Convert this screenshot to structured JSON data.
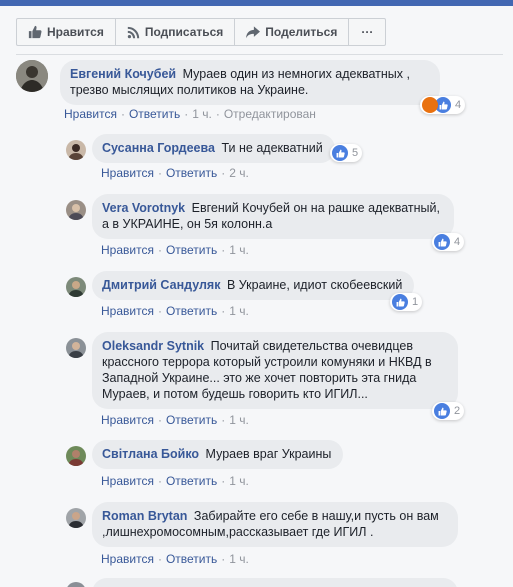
{
  "actions": {
    "like": "Нравится",
    "subscribe": "Подписаться",
    "share": "Поделиться",
    "more": "···"
  },
  "meta": {
    "like": "Нравится",
    "reply": "Ответить",
    "edited": "Отредактирован"
  },
  "comments": [
    {
      "name": "Евгений Кочубей",
      "text": "Мураев один из немногих адекватных , трезво мыслящих политиков на Украине.",
      "time": "1 ч.",
      "reactions": "4"
    },
    {
      "name": "Сусанна Гордеева",
      "text": "Ти не адекватний",
      "time": "2 ч.",
      "reactions": "5"
    },
    {
      "name": "Vera Vorotnyk",
      "text": "Евгений Кочубей он на рашке адекватный, а в УКРАИНЕ, он 5я колонн.а",
      "time": "1 ч.",
      "reactions": "4"
    },
    {
      "name": "Дмитрий Сандуляк",
      "text": "В Украине, идиот скобеевский",
      "time": "1 ч.",
      "reactions": "1"
    },
    {
      "name": "Oleksandr Sytnik",
      "text": "Почитай свидетельства очевидцев крассного террора который устроили комуняки и НКВД в Западной Украине... это же хочет повторить эта гнида Мураев, и потом будешь говорить кто ИГИЛ...",
      "time": "1 ч.",
      "reactions": "2"
    },
    {
      "name": "Світлана Бойко",
      "text": "Мураев враг Украины",
      "time": "1 ч."
    },
    {
      "name": "Roman Brytan",
      "text": "Забирайте его себе в нашу,и пусть он вам ,лишнехромосомным,рассказывает где ИГИЛ .",
      "time": "1 ч."
    }
  ]
}
